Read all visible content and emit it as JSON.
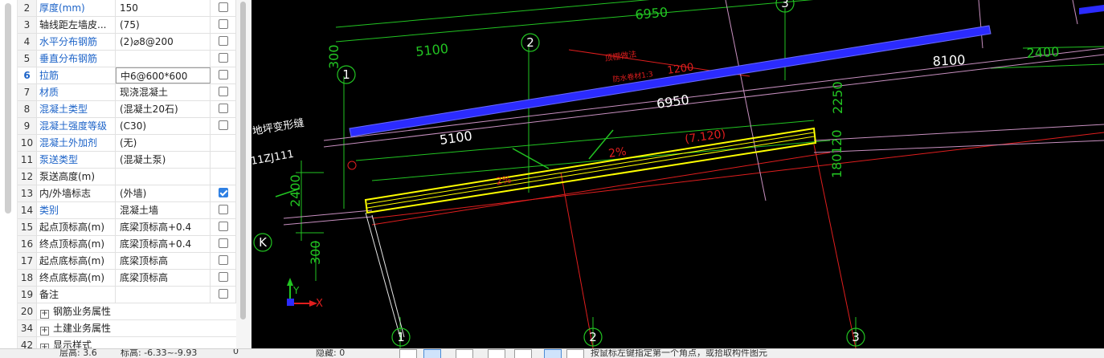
{
  "properties": {
    "rows": [
      {
        "num": "2",
        "name": "厚度(mm)",
        "value": "150",
        "blue": true,
        "check": "off"
      },
      {
        "num": "3",
        "name": "轴线距左墙皮...",
        "value": "(75)",
        "blue": false,
        "check": "off"
      },
      {
        "num": "4",
        "name": "水平分布钢筋",
        "value": "(2)⌀8@200",
        "blue": true,
        "check": "off"
      },
      {
        "num": "5",
        "name": "垂直分布钢筋",
        "value": "",
        "blue": true,
        "check": "off"
      },
      {
        "num": "6",
        "name": "拉筋",
        "value": "中6@600*600",
        "blue": true,
        "check": "off",
        "selected": true
      },
      {
        "num": "7",
        "name": "材质",
        "value": "现浇混凝土",
        "blue": true,
        "check": "off"
      },
      {
        "num": "8",
        "name": "混凝土类型",
        "value": "(混凝土20石)",
        "blue": true,
        "check": "off"
      },
      {
        "num": "9",
        "name": "混凝土强度等级",
        "value": "(C30)",
        "blue": true,
        "check": "off"
      },
      {
        "num": "10",
        "name": "混凝土外加剂",
        "value": "(无)",
        "blue": true,
        "check": "none"
      },
      {
        "num": "11",
        "name": "泵送类型",
        "value": "(混凝土泵)",
        "blue": true,
        "check": "none"
      },
      {
        "num": "12",
        "name": "泵送高度(m)",
        "value": "",
        "blue": false,
        "check": "none"
      },
      {
        "num": "13",
        "name": "内/外墙标志",
        "value": "(外墙)",
        "blue": false,
        "check": "on"
      },
      {
        "num": "14",
        "name": "类别",
        "value": "混凝土墙",
        "blue": true,
        "check": "off"
      },
      {
        "num": "15",
        "name": "起点顶标高(m)",
        "value": "底梁顶标高+0.4",
        "blue": false,
        "check": "off"
      },
      {
        "num": "16",
        "name": "终点顶标高(m)",
        "value": "底梁顶标高+0.4",
        "blue": false,
        "check": "off"
      },
      {
        "num": "17",
        "name": "起点底标高(m)",
        "value": "底梁顶标高",
        "blue": false,
        "check": "off"
      },
      {
        "num": "18",
        "name": "终点底标高(m)",
        "value": "底梁顶标高",
        "blue": false,
        "check": "off"
      },
      {
        "num": "19",
        "name": "备注",
        "value": "",
        "blue": false,
        "check": "off"
      }
    ],
    "groups": [
      {
        "num": "20",
        "label": "钢筋业务属性",
        "symbol": "+"
      },
      {
        "num": "34",
        "label": "土建业务属性",
        "symbol": "+"
      },
      {
        "num": "42",
        "label": "显示样式",
        "symbol": "+"
      }
    ]
  },
  "cad": {
    "dims": {
      "top_6950": "6950",
      "upper_5100": "5100",
      "mid_6950": "6950",
      "lower_5100": "5100",
      "right_8100": "8100",
      "right_2400": "2400",
      "left_300": "300",
      "v_2250": "2250",
      "v_120": "120",
      "v_180": "180",
      "v_2400": "2400",
      "v_300": "300",
      "dim_1200": "1200",
      "elev": "(7.120)",
      "slope_1": "2%",
      "slope_2": "2%"
    },
    "notes": {
      "joint": "地坪变形缝",
      "ref": "11ZJ111",
      "red_note_1": "顶棚做法",
      "red_note_2": "防水卷材1:3"
    },
    "axes": {
      "axis_1_left": "1",
      "axis_2_top": "2",
      "axis_3_top": "3",
      "axis_k": "K",
      "bottom_1": "1",
      "bottom_2": "2",
      "bottom_3": "3"
    },
    "ucs": {
      "x": "X",
      "y": "Y"
    },
    "colors": {
      "background": "#000000",
      "wall_blue": "#2b2bff",
      "wall_yellow": "#ffff00",
      "grid_green": "#22c422",
      "dim_red": "#e01e1e"
    }
  },
  "status": {
    "floor": "层高: 3.6",
    "elev": "标高: -6.33~-9.93",
    "zero": "0",
    "hidden": "隐藏: 0",
    "hint": "按鼠标左键指定第一个角点，或拾取构件图元"
  }
}
